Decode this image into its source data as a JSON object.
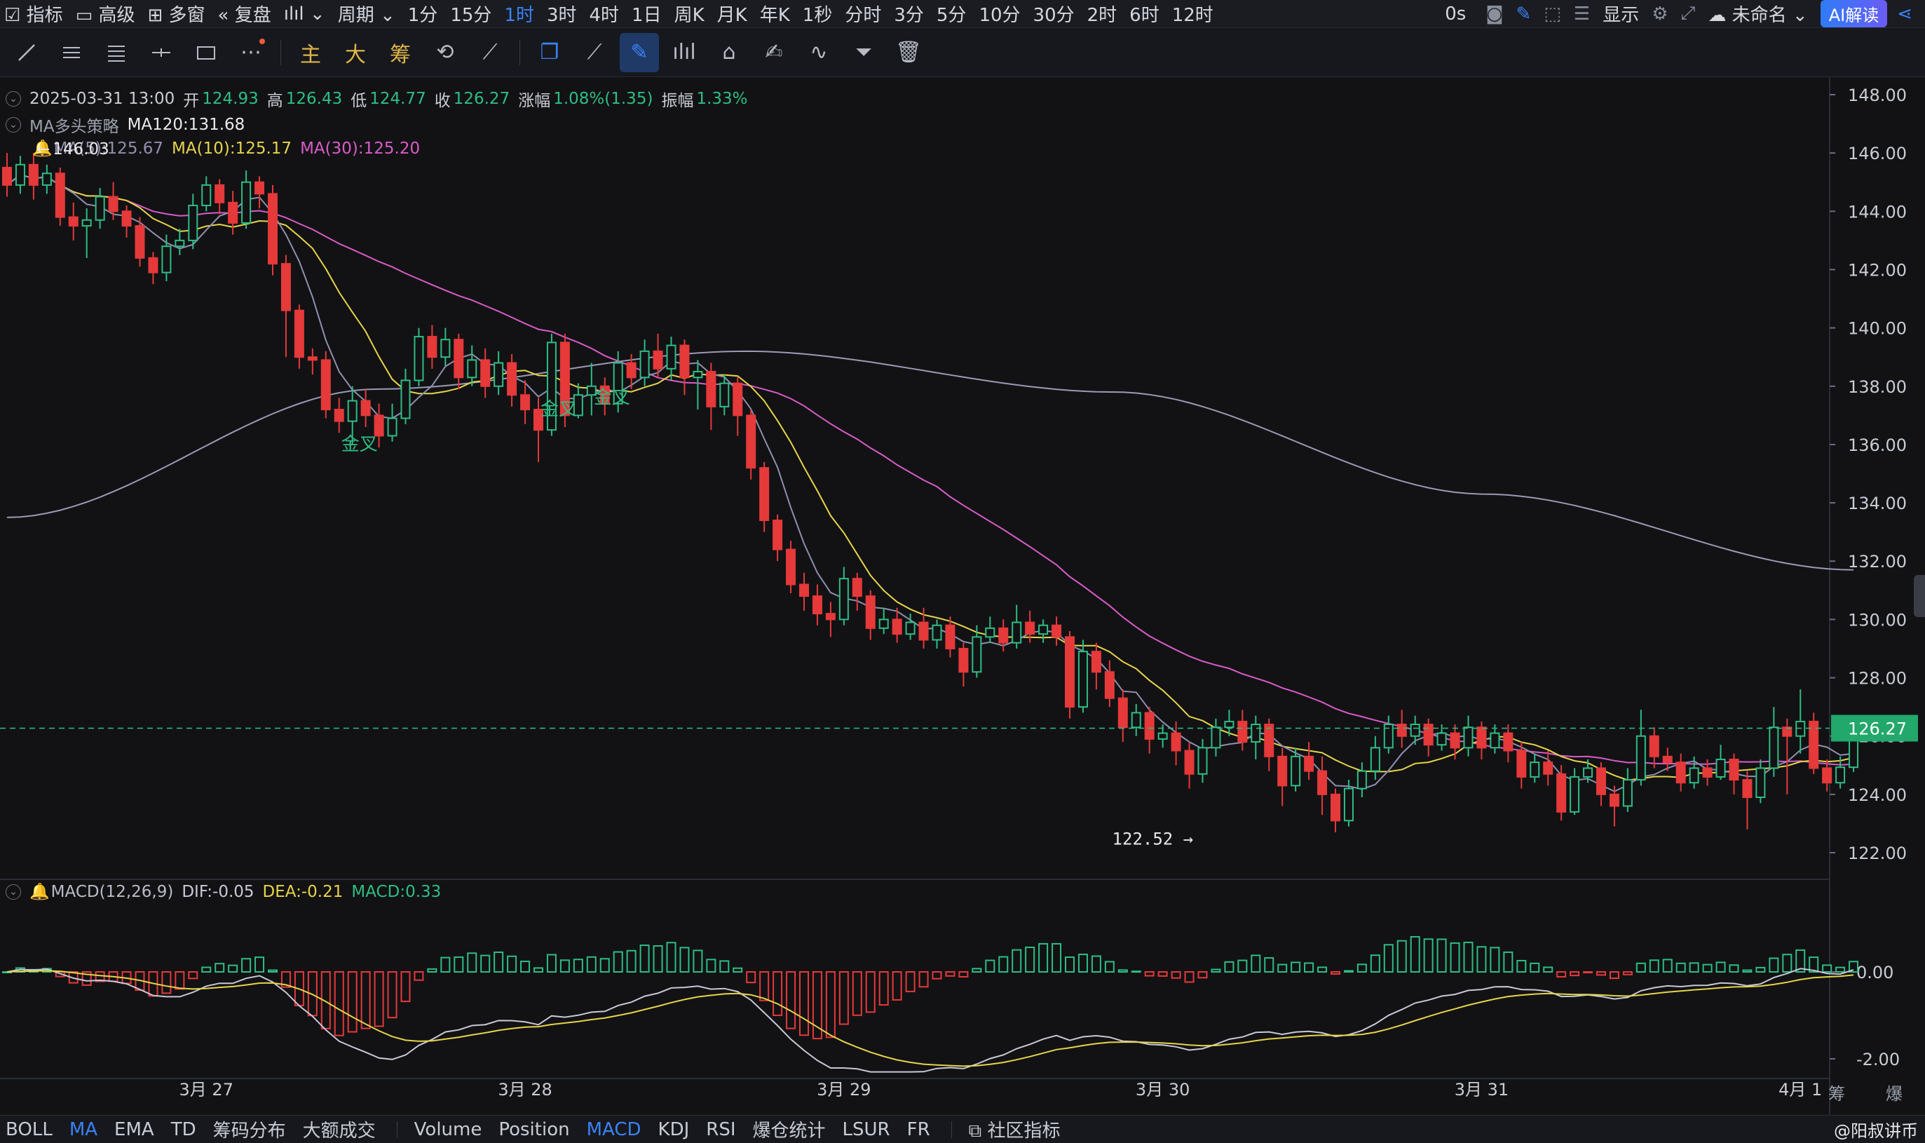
{
  "topbar": {
    "items": [
      "指标",
      "高级",
      "多窗",
      "复盘",
      "",
      "周期",
      "1分",
      "15分",
      "1时",
      "3时",
      "4时",
      "1日",
      "周K",
      "月K",
      "年K",
      "1秒",
      "分时",
      "3分",
      "5分",
      "10分",
      "30分",
      "2时",
      "6时",
      "12时"
    ],
    "active": "1时",
    "countdown": "0s",
    "display_label": "显示",
    "layout_name": "未命名",
    "ai_button": "AI解读"
  },
  "toolbar": {
    "text_tools": [
      "主",
      "大",
      "筹"
    ]
  },
  "info": {
    "ohlc": {
      "datetime": "2025-03-31 13:00",
      "open_label": "开",
      "open": "124.93",
      "high_label": "高",
      "high": "126.43",
      "low_label": "低",
      "low": "124.77",
      "close_label": "收",
      "close": "126.27",
      "change_label": "涨幅",
      "change": "1.08%(1.35)",
      "amp_label": "振幅",
      "amp": "1.33%"
    },
    "strategy": {
      "name": "MA多头策略",
      "ma120": "MA120:131.68"
    },
    "ma_line": {
      "ma5": "MA(5):125.67",
      "ma10": "MA(10):125.17",
      "ma30": "MA(30):125.20",
      "hi_marker": "146.03"
    },
    "macd": {
      "name": "MACD(12,26,9)",
      "dif": "DIF:-0.05",
      "dea": "DEA:-0.21",
      "macd": "MACD:0.33"
    }
  },
  "colors": {
    "up": "#2ebd85",
    "down": "#e5393a",
    "ma5": "#8f8fb0",
    "ma10": "#e6d44a",
    "ma30": "#d85cc8",
    "ma120": "#9a9ab8",
    "dif": "#c8c8d8",
    "dea": "#e6d44a",
    "accent": "#3b82f6"
  },
  "bottombar": {
    "items": [
      "BOLL",
      "MA",
      "EMA",
      "TD",
      "筹码分布",
      "大额成交",
      "Volume",
      "Position",
      "MACD",
      "KDJ",
      "RSI",
      "爆仓统计",
      "LSUR",
      "FR",
      "社区指标"
    ],
    "active": [
      "MA",
      "MACD"
    ]
  },
  "right_tags": {
    "chips": "筹",
    "burst": "爆"
  },
  "watermark": "@阳叔讲币",
  "chart_data": {
    "type": "candlestick",
    "interval": "1h",
    "y_ticks": [
      "148.00",
      "146.00",
      "144.00",
      "142.00",
      "140.00",
      "138.00",
      "136.00",
      "134.00",
      "132.00",
      "130.00",
      "128.00",
      "126.00",
      "124.00",
      "122.00"
    ],
    "ylim": [
      121.4,
      148.4
    ],
    "x_ticks": [
      {
        "label": "3月 27",
        "index": 15
      },
      {
        "label": "3月 28",
        "index": 39
      },
      {
        "label": "3月 29",
        "index": 63
      },
      {
        "label": "3月 30",
        "index": 87
      },
      {
        "label": "3月 31",
        "index": 111
      },
      {
        "label": "4月 1",
        "index": 135
      }
    ],
    "last_price": "126.27",
    "low_marker": {
      "label": "122.52",
      "index": 89,
      "value": 122.52
    },
    "signals": [
      {
        "label": "金叉",
        "index": 26,
        "value": 136.0
      },
      {
        "label": "金叉",
        "index": 41,
        "value": 137.2
      },
      {
        "label": "金叉",
        "index": 45,
        "value": 137.6
      }
    ],
    "candles": [
      [
        145.5,
        144.9,
        146.0,
        144.5
      ],
      [
        144.9,
        145.6,
        145.9,
        144.6
      ],
      [
        145.6,
        144.9,
        146.0,
        144.4
      ],
      [
        144.9,
        145.3,
        145.6,
        144.6
      ],
      [
        145.3,
        143.8,
        145.5,
        143.5
      ],
      [
        143.8,
        143.5,
        144.3,
        143.0
      ],
      [
        143.5,
        143.7,
        144.1,
        142.4
      ],
      [
        143.7,
        144.5,
        144.8,
        143.4
      ],
      [
        144.5,
        144.0,
        145.0,
        143.7
      ],
      [
        144.0,
        143.5,
        144.2,
        143.1
      ],
      [
        143.5,
        142.4,
        143.8,
        142.1
      ],
      [
        142.4,
        141.9,
        142.6,
        141.5
      ],
      [
        141.9,
        142.8,
        143.2,
        141.6
      ],
      [
        142.8,
        143.0,
        143.4,
        142.5
      ],
      [
        143.0,
        144.2,
        144.6,
        142.7
      ],
      [
        144.2,
        144.9,
        145.2,
        144.0
      ],
      [
        144.9,
        144.3,
        145.1,
        143.9
      ],
      [
        144.3,
        143.6,
        144.7,
        143.2
      ],
      [
        143.6,
        145.0,
        145.4,
        143.4
      ],
      [
        145.0,
        144.6,
        145.2,
        144.1
      ],
      [
        144.6,
        142.2,
        144.9,
        141.8
      ],
      [
        142.2,
        140.6,
        142.5,
        139.0
      ],
      [
        140.6,
        139.0,
        140.8,
        138.6
      ],
      [
        139.0,
        138.9,
        139.3,
        138.4
      ],
      [
        138.9,
        137.2,
        139.2,
        136.9
      ],
      [
        137.2,
        136.8,
        137.6,
        136.4
      ],
      [
        136.8,
        137.5,
        138.0,
        136.0
      ],
      [
        137.5,
        137.0,
        137.9,
        136.6
      ],
      [
        137.0,
        136.3,
        137.4,
        135.9
      ],
      [
        136.3,
        136.9,
        137.4,
        136.1
      ],
      [
        136.9,
        138.2,
        138.6,
        136.7
      ],
      [
        138.2,
        139.7,
        140.0,
        138.0
      ],
      [
        139.7,
        139.0,
        140.1,
        138.6
      ],
      [
        139.0,
        139.6,
        140.0,
        138.7
      ],
      [
        139.6,
        138.3,
        139.8,
        137.9
      ],
      [
        138.3,
        138.9,
        139.4,
        138.0
      ],
      [
        138.9,
        138.0,
        139.3,
        137.6
      ],
      [
        138.0,
        138.8,
        139.2,
        137.7
      ],
      [
        138.8,
        137.7,
        139.1,
        137.3
      ],
      [
        137.7,
        137.2,
        138.2,
        136.7
      ],
      [
        137.2,
        136.5,
        137.6,
        135.4
      ],
      [
        136.5,
        139.5,
        139.8,
        136.3
      ],
      [
        139.5,
        137.0,
        139.8,
        136.6
      ],
      [
        137.0,
        137.7,
        138.1,
        136.9
      ],
      [
        137.7,
        138.0,
        138.8,
        137.0
      ],
      [
        138.0,
        137.4,
        138.3,
        137.0
      ],
      [
        137.4,
        138.8,
        139.2,
        137.1
      ],
      [
        138.8,
        138.3,
        139.1,
        137.9
      ],
      [
        138.3,
        139.2,
        139.6,
        138.0
      ],
      [
        139.2,
        138.6,
        139.8,
        138.3
      ],
      [
        138.6,
        139.4,
        139.7,
        138.2
      ],
      [
        139.4,
        138.3,
        139.6,
        137.7
      ],
      [
        138.3,
        138.5,
        138.9,
        137.2
      ],
      [
        138.5,
        137.3,
        138.8,
        136.5
      ],
      [
        137.3,
        138.1,
        138.4,
        137.0
      ],
      [
        138.1,
        137.0,
        138.3,
        136.3
      ],
      [
        137.0,
        135.2,
        137.2,
        134.8
      ],
      [
        135.2,
        133.4,
        135.4,
        133.0
      ],
      [
        133.4,
        132.4,
        133.6,
        132.0
      ],
      [
        132.4,
        131.2,
        132.7,
        130.9
      ],
      [
        131.2,
        130.8,
        131.6,
        130.3
      ],
      [
        130.8,
        130.2,
        131.2,
        129.8
      ],
      [
        130.2,
        130.0,
        130.6,
        129.4
      ],
      [
        130.0,
        131.4,
        131.8,
        129.8
      ],
      [
        131.4,
        130.8,
        131.6,
        130.3
      ],
      [
        130.8,
        129.7,
        131.0,
        129.3
      ],
      [
        129.7,
        130.0,
        130.4,
        129.5
      ],
      [
        130.0,
        129.5,
        130.4,
        129.2
      ],
      [
        129.5,
        129.9,
        130.2,
        129.3
      ],
      [
        129.9,
        129.3,
        130.4,
        129.0
      ],
      [
        129.3,
        129.8,
        130.0,
        129.0
      ],
      [
        129.8,
        129.0,
        130.1,
        128.7
      ],
      [
        129.0,
        128.2,
        129.2,
        127.7
      ],
      [
        128.2,
        129.4,
        129.8,
        128.0
      ],
      [
        129.4,
        129.7,
        130.1,
        129.2
      ],
      [
        129.7,
        129.2,
        130.0,
        128.9
      ],
      [
        129.2,
        129.9,
        130.5,
        129.0
      ],
      [
        129.9,
        129.5,
        130.3,
        129.2
      ],
      [
        129.5,
        129.8,
        130.0,
        129.2
      ],
      [
        129.8,
        129.4,
        130.1,
        129.1
      ],
      [
        129.4,
        127.0,
        129.6,
        126.6
      ],
      [
        127.0,
        128.9,
        129.3,
        126.8
      ],
      [
        128.9,
        128.2,
        129.2,
        127.6
      ],
      [
        128.2,
        127.3,
        128.6,
        127.0
      ],
      [
        127.3,
        126.3,
        127.6,
        125.8
      ],
      [
        126.3,
        126.8,
        127.1,
        126.0
      ],
      [
        126.8,
        125.9,
        127.0,
        125.4
      ],
      [
        125.9,
        126.1,
        126.4,
        125.6
      ],
      [
        126.1,
        125.5,
        126.5,
        125.0
      ],
      [
        125.5,
        124.7,
        125.8,
        124.2
      ],
      [
        124.7,
        125.6,
        125.9,
        124.4
      ],
      [
        125.6,
        126.3,
        126.6,
        125.3
      ],
      [
        126.3,
        126.5,
        126.9,
        126.0
      ],
      [
        126.5,
        125.8,
        126.9,
        125.5
      ],
      [
        125.8,
        126.4,
        126.7,
        125.2
      ],
      [
        126.4,
        125.3,
        126.6,
        124.8
      ],
      [
        125.3,
        124.3,
        125.6,
        123.6
      ],
      [
        124.3,
        125.3,
        125.6,
        124.1
      ],
      [
        125.3,
        124.8,
        125.8,
        124.5
      ],
      [
        124.8,
        124.0,
        125.3,
        123.3
      ],
      [
        124.0,
        123.1,
        124.2,
        122.7
      ],
      [
        123.1,
        124.2,
        124.5,
        122.9
      ],
      [
        124.2,
        124.8,
        125.1,
        123.9
      ],
      [
        124.8,
        125.6,
        126.0,
        124.5
      ],
      [
        125.6,
        126.4,
        126.7,
        125.4
      ],
      [
        126.4,
        126.0,
        126.9,
        125.6
      ],
      [
        126.0,
        126.4,
        126.7,
        125.7
      ],
      [
        126.4,
        125.7,
        126.6,
        125.3
      ],
      [
        125.7,
        126.1,
        126.4,
        125.5
      ],
      [
        126.1,
        125.6,
        126.4,
        125.2
      ],
      [
        125.6,
        126.3,
        126.7,
        125.3
      ],
      [
        126.3,
        125.6,
        126.5,
        125.2
      ],
      [
        125.6,
        126.1,
        126.4,
        125.4
      ],
      [
        126.1,
        125.5,
        126.4,
        125.1
      ],
      [
        125.5,
        124.6,
        125.8,
        124.2
      ],
      [
        124.6,
        125.1,
        125.4,
        124.4
      ],
      [
        125.1,
        124.7,
        125.5,
        124.3
      ],
      [
        124.7,
        123.4,
        125.0,
        123.1
      ],
      [
        123.4,
        124.6,
        124.9,
        123.3
      ],
      [
        124.6,
        124.9,
        125.2,
        124.4
      ],
      [
        124.9,
        124.0,
        125.1,
        123.6
      ],
      [
        124.0,
        123.6,
        124.3,
        122.9
      ],
      [
        123.6,
        124.5,
        124.9,
        123.4
      ],
      [
        124.5,
        126.0,
        126.9,
        124.3
      ],
      [
        126.0,
        125.3,
        126.3,
        124.9
      ],
      [
        125.3,
        125.1,
        125.6,
        124.8
      ],
      [
        125.1,
        124.4,
        125.4,
        124.1
      ],
      [
        124.4,
        124.9,
        125.3,
        124.2
      ],
      [
        124.9,
        124.6,
        125.2,
        124.3
      ],
      [
        124.6,
        125.2,
        125.7,
        124.5
      ],
      [
        125.2,
        124.5,
        125.4,
        124.0
      ],
      [
        124.5,
        123.9,
        124.8,
        122.8
      ],
      [
        123.9,
        124.9,
        125.2,
        123.7
      ],
      [
        124.9,
        126.3,
        127.0,
        124.6
      ],
      [
        126.3,
        126.0,
        126.6,
        124.0
      ],
      [
        126.0,
        126.5,
        127.6,
        125.4
      ],
      [
        126.5,
        124.9,
        126.8,
        124.7
      ],
      [
        124.9,
        124.4,
        125.2,
        124.1
      ],
      [
        124.4,
        124.93,
        125.3,
        124.2
      ],
      [
        124.93,
        126.27,
        126.43,
        124.77
      ]
    ],
    "macd_axis": [
      "0.00",
      "-2.00"
    ],
    "macd_ylim": [
      -2.3,
      1.6
    ]
  }
}
